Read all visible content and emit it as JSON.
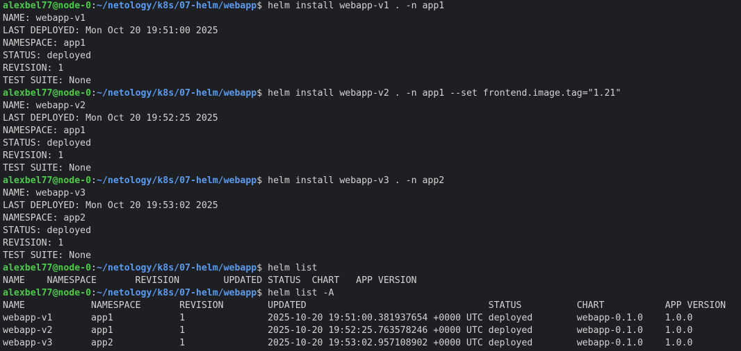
{
  "colors": {
    "background": "#1e1f22",
    "prompt_user": "#4ec94e",
    "prompt_path": "#5a9bf0",
    "text": "#d4d4d4"
  },
  "prompt": {
    "user_host": "alexbel77@node-0",
    "colon": ":",
    "path": "~/netology/k8s/07-helm/webapp",
    "symbol": "$ "
  },
  "blocks": [
    {
      "command": "helm install webapp-v1 . -n app1",
      "output": [
        "NAME: webapp-v1",
        "LAST DEPLOYED: Mon Oct 20 19:51:00 2025",
        "NAMESPACE: app1",
        "STATUS: deployed",
        "REVISION: 1",
        "TEST SUITE: None"
      ]
    },
    {
      "command": "helm install webapp-v2 . -n app1 --set frontend.image.tag=\"1.21\"",
      "output": [
        "NAME: webapp-v2",
        "LAST DEPLOYED: Mon Oct 20 19:52:25 2025",
        "NAMESPACE: app1",
        "STATUS: deployed",
        "REVISION: 1",
        "TEST SUITE: None"
      ]
    },
    {
      "command": "helm install webapp-v3 . -n app2",
      "output": [
        "NAME: webapp-v3",
        "LAST DEPLOYED: Mon Oct 20 19:53:02 2025",
        "NAMESPACE: app2",
        "STATUS: deployed",
        "REVISION: 1",
        "TEST SUITE: None"
      ]
    },
    {
      "command": "helm list",
      "output": [
        "NAME    NAMESPACE       REVISION        UPDATED STATUS  CHART   APP VERSION"
      ]
    },
    {
      "command": "helm list -A",
      "output": [
        "NAME            NAMESPACE       REVISION        UPDATED                                 STATUS          CHART           APP VERSION",
        "webapp-v1       app1            1               2025-10-20 19:51:00.381937654 +0000 UTC deployed        webapp-0.1.0    1.0.0",
        "webapp-v2       app1            1               2025-10-20 19:52:25.763578246 +0000 UTC deployed        webapp-0.1.0    1.0.0",
        "webapp-v3       app2            1               2025-10-20 19:53:02.957108902 +0000 UTC deployed        webapp-0.1.0    1.0.0"
      ]
    }
  ]
}
